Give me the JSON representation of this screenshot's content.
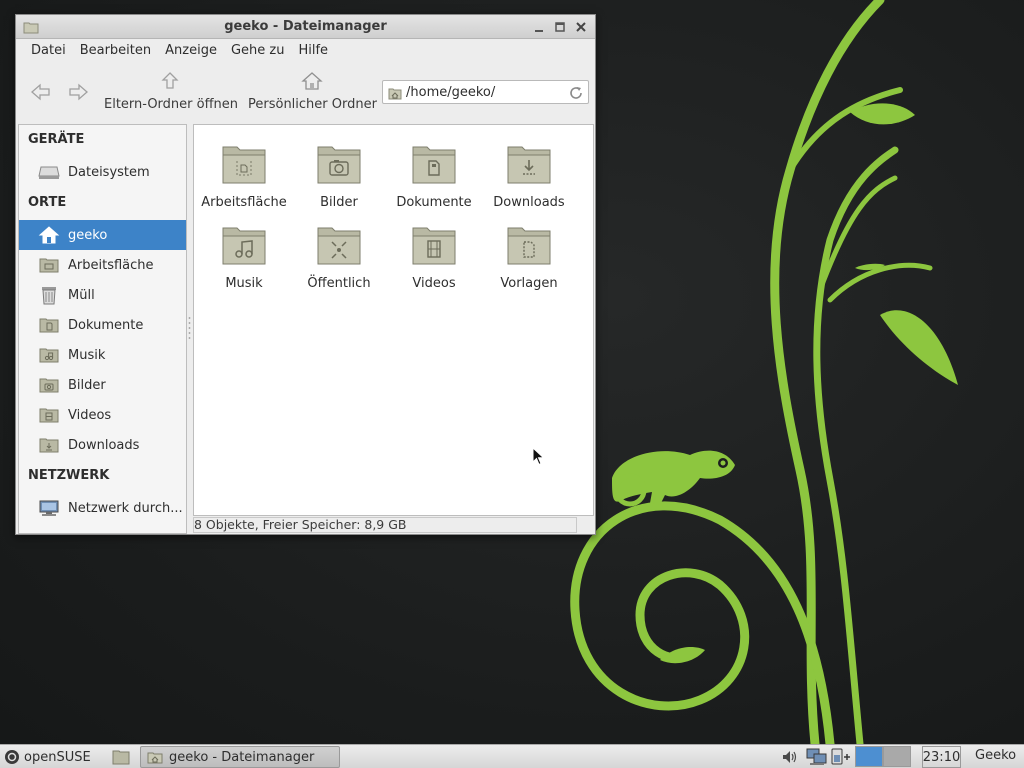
{
  "window": {
    "title": "geeko - Dateimanager",
    "menu": [
      "Datei",
      "Bearbeiten",
      "Anzeige",
      "Gehe zu",
      "Hilfe"
    ],
    "toolbar": {
      "back_icon": "back-arrow-icon",
      "forward_icon": "forward-arrow-icon",
      "parent_label": "Eltern-Ordner öffnen",
      "home_label": "Persönlicher Ordner"
    },
    "address": "/home/geeko/",
    "sidebar": {
      "devices_header": "GERÄTE",
      "devices": [
        {
          "label": "Dateisystem",
          "icon": "harddisk-icon"
        }
      ],
      "places_header": "ORTE",
      "places": [
        {
          "label": "geeko",
          "icon": "home-icon",
          "selected": true
        },
        {
          "label": "Arbeitsfläche",
          "icon": "desktop-folder-icon"
        },
        {
          "label": "Müll",
          "icon": "trash-icon"
        },
        {
          "label": "Dokumente",
          "icon": "documents-folder-icon"
        },
        {
          "label": "Musik",
          "icon": "music-folder-icon"
        },
        {
          "label": "Bilder",
          "icon": "pictures-folder-icon"
        },
        {
          "label": "Videos",
          "icon": "videos-folder-icon"
        },
        {
          "label": "Downloads",
          "icon": "downloads-folder-icon"
        }
      ],
      "network_header": "NETZWERK",
      "network": [
        {
          "label": "Netzwerk durch...",
          "icon": "network-icon"
        }
      ]
    },
    "files": [
      {
        "label": "Arbeitsfläche",
        "icon": "desktop-folder-icon"
      },
      {
        "label": "Bilder",
        "icon": "pictures-folder-icon"
      },
      {
        "label": "Dokumente",
        "icon": "documents-folder-icon"
      },
      {
        "label": "Downloads",
        "icon": "downloads-folder-icon"
      },
      {
        "label": "Musik",
        "icon": "music-folder-icon"
      },
      {
        "label": "Öffentlich",
        "icon": "public-folder-icon"
      },
      {
        "label": "Videos",
        "icon": "videos-folder-icon"
      },
      {
        "label": "Vorlagen",
        "icon": "templates-folder-icon"
      }
    ],
    "status": "8 Objekte, Freier Speicher: 8,9 GB"
  },
  "taskbar": {
    "start_label": "openSUSE",
    "task_label": "geeko - Dateimanager",
    "clock": "23:10",
    "user": "Geeko"
  },
  "colors": {
    "selection": "#3d83c8",
    "folder": "#b9b9a4",
    "wallpaper_green": "#8dc63f"
  }
}
